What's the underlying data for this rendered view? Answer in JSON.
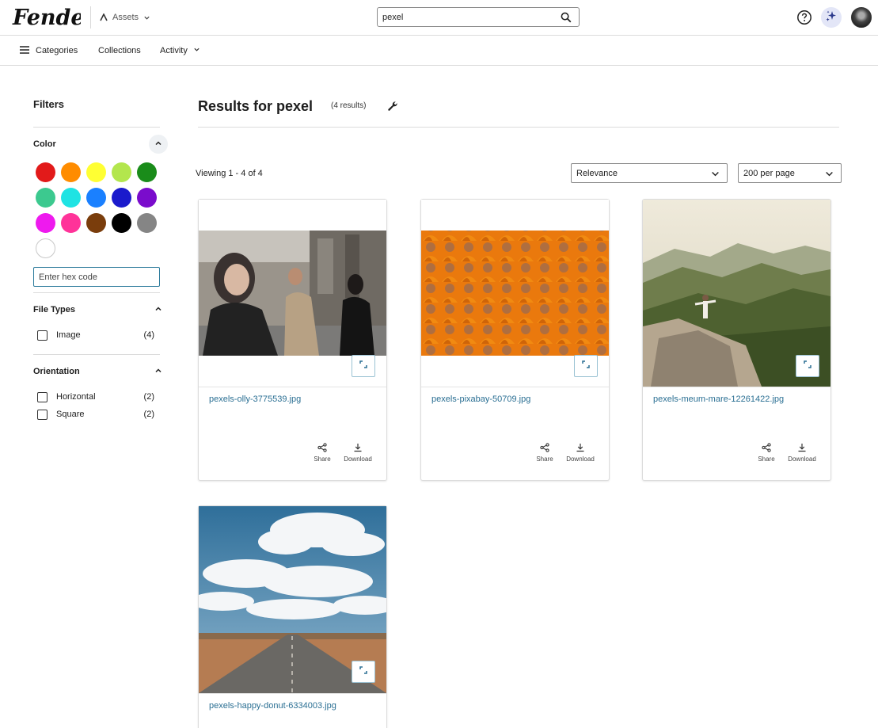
{
  "header": {
    "logo_text": "Fender",
    "app_switcher_label": "Assets",
    "search_value": "pexel"
  },
  "nav": {
    "categories": "Categories",
    "collections": "Collections",
    "activity": "Activity"
  },
  "filters": {
    "title": "Filters",
    "color": {
      "label": "Color",
      "swatches": [
        "#e21a1a",
        "#ff8c00",
        "#ffff33",
        "#b3e64d",
        "#1a8c1a",
        "#3cc98f",
        "#1fe3e3",
        "#1a80ff",
        "#1a1acc",
        "#7a0ccc",
        "#ee1aee",
        "#ff3399",
        "#7a3d0c",
        "#000000",
        "#858585",
        "#ffffff"
      ],
      "hex_placeholder": "Enter hex code"
    },
    "file_types": {
      "label": "File Types",
      "options": [
        {
          "label": "Image",
          "count": "(4)"
        }
      ]
    },
    "orientation": {
      "label": "Orientation",
      "options": [
        {
          "label": "Horizontal",
          "count": "(2)"
        },
        {
          "label": "Square",
          "count": "(2)"
        }
      ]
    }
  },
  "results": {
    "title": "Results for pexel",
    "count": "(4 results)",
    "viewing": "Viewing 1 - 4 of 4",
    "sort_value": "Relevance",
    "per_page_value": "200 per page"
  },
  "cards": [
    {
      "filename": "pexels-olly-3775539.jpg",
      "share": "Share",
      "download": "Download"
    },
    {
      "filename": "pexels-pixabay-50709.jpg",
      "share": "Share",
      "download": "Download"
    },
    {
      "filename": "pexels-meum-mare-12261422.jpg",
      "share": "Share",
      "download": "Download"
    },
    {
      "filename": "pexels-happy-donut-6334003.jpg"
    }
  ]
}
